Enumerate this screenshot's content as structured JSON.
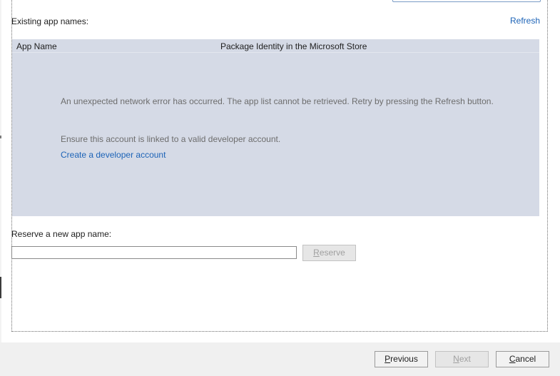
{
  "existing": {
    "label": "Existing app names:",
    "refresh_label": "Refresh"
  },
  "grid": {
    "columns": [
      "App Name",
      "Package Identity in the Microsoft Store"
    ],
    "error_message": "An unexpected network error has occurred. The app list cannot be retrieved. Retry by pressing the Refresh button.",
    "ensure_message": "Ensure this account is linked to a valid developer account.",
    "dev_account_link": "Create a developer account"
  },
  "reserve": {
    "label": "Reserve a new app name:",
    "input_value": "",
    "button_first": "R",
    "button_rest": "eserve"
  },
  "footer": {
    "previous_first": "P",
    "previous_rest": "revious",
    "next_first": "N",
    "next_rest": "ext",
    "cancel_first": "C",
    "cancel_rest": "ancel"
  }
}
